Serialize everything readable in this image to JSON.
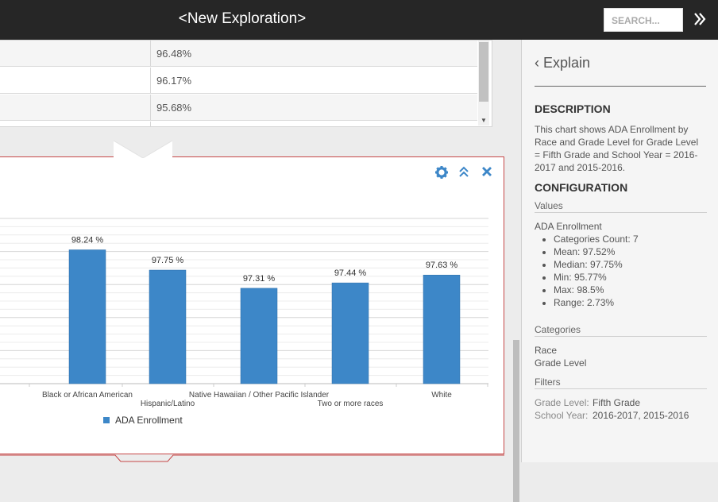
{
  "header": {
    "title": "<New Exploration>",
    "search_placeholder": "SEARCH...",
    "expand_icon": "double-chevron-right-icon"
  },
  "table": {
    "rows": [
      {
        "value": "96.48%"
      },
      {
        "value": "96.17%"
      },
      {
        "value": "95.68%"
      }
    ]
  },
  "chart_controls": {
    "settings_icon": "gear-icon",
    "collapse_icon": "double-chevron-up-icon",
    "close_icon": "close-icon"
  },
  "chart_data": {
    "type": "bar",
    "categories": [
      "Black or African American",
      "Hispanic/Latino",
      "Native Hawaiian / Other Pacific Islander",
      "Two or more races",
      "White"
    ],
    "series": [
      {
        "name": "ADA Enrollment",
        "values": [
          98.24,
          97.75,
          97.31,
          97.44,
          97.63
        ],
        "color": "#3d87c8"
      }
    ],
    "data_labels": [
      "98.24 %",
      "97.75 %",
      "97.31 %",
      "97.44 %",
      "97.63 %"
    ],
    "ylim": [
      95.0,
      99.0
    ],
    "grid": true,
    "legend_position": "bottom-left"
  },
  "explain": {
    "title": "Explain",
    "description_heading": "DESCRIPTION",
    "description": "This chart shows ADA Enrollment by Race and Grade Level for Grade Level = Fifth Grade and School Year = 2016-2017 and 2015-2016.",
    "configuration_heading": "CONFIGURATION",
    "values_label": "Values",
    "value_name": "ADA Enrollment",
    "stats": [
      "Categories Count: 7",
      "Mean: 97.52%",
      "Median: 97.75%",
      "Min: 95.77%",
      "Max: 98.5%",
      "Range: 2.73%"
    ],
    "categories_label": "Categories",
    "categories": [
      "Race",
      "Grade Level"
    ],
    "filters_label": "Filters",
    "filters": [
      {
        "key": "Grade Level:",
        "value": "Fifth Grade"
      },
      {
        "key": "School Year:",
        "value": "2016-2017, 2015-2016"
      }
    ]
  }
}
